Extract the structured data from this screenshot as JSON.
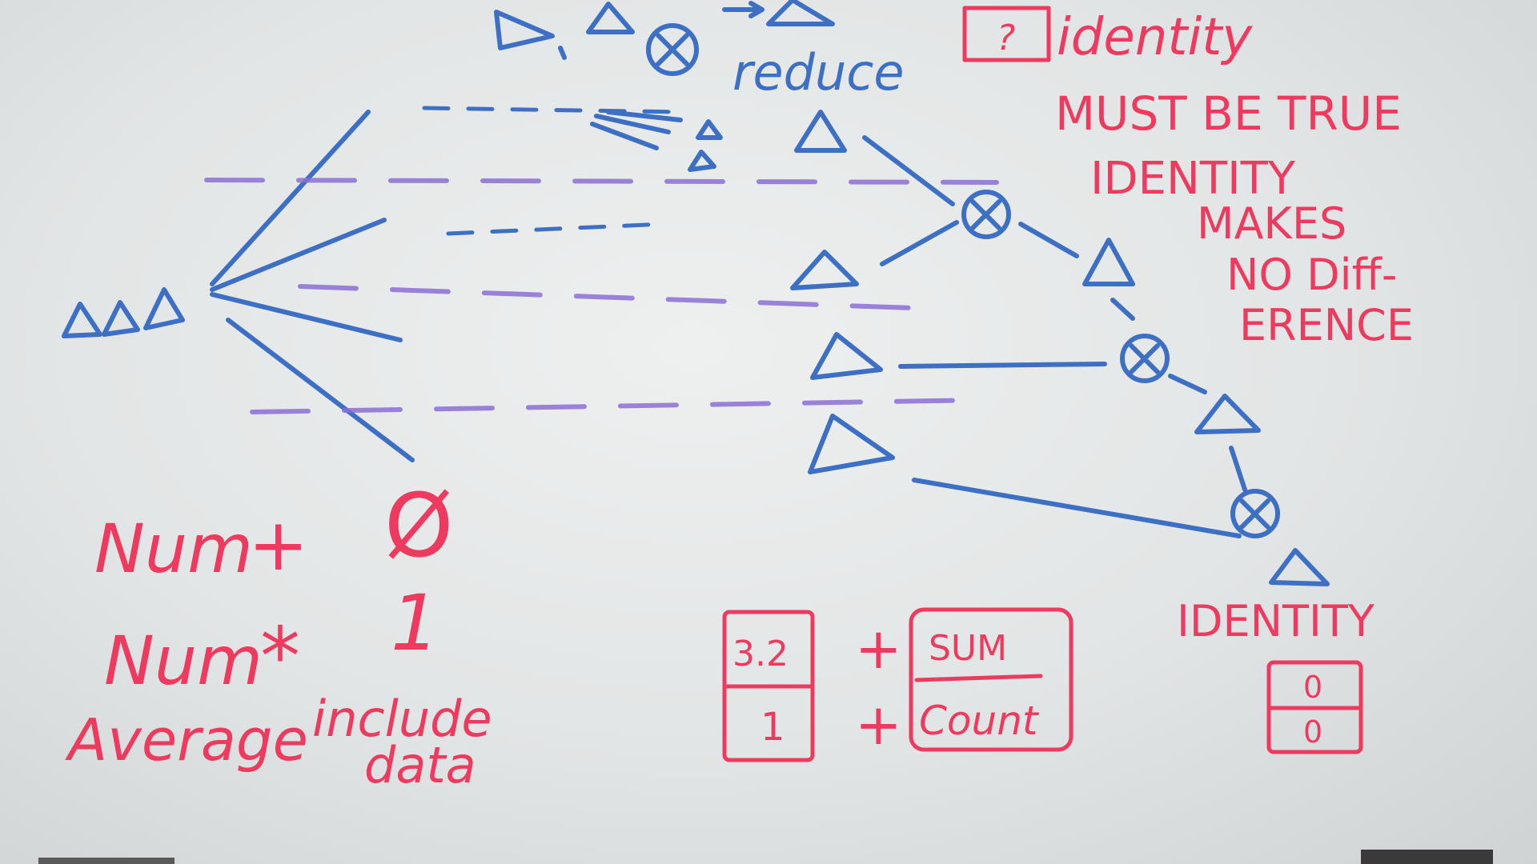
{
  "header": {
    "reduce_label": "reduce",
    "question_box": "?",
    "identity_heading": "identity"
  },
  "rules": [
    "MUST BE TRUE",
    "IDENTITY",
    "MAKES",
    "NO Diff-",
    "ERENCE"
  ],
  "examples": {
    "sum": {
      "left": "Num",
      "op": "+",
      "identity": "Ø"
    },
    "product": {
      "left": "Num",
      "op": "*",
      "identity": "1"
    },
    "average": {
      "left": "Average",
      "note_line1": "include",
      "note_line2": "data"
    }
  },
  "average_pair": {
    "value_top": "3.2",
    "value_bottom": "1",
    "plus_top": "+",
    "plus_bottom": "+",
    "acc_top": "SUM",
    "acc_bottom": "Count"
  },
  "identity_pair": {
    "label": "IDENTITY",
    "top": "0",
    "bottom": "0"
  },
  "colors": {
    "blue_marker": "#3d6fc4",
    "red_marker": "#ee3a5e",
    "purple_marker": "#8c6fd6",
    "board": "#e6e9e9"
  }
}
